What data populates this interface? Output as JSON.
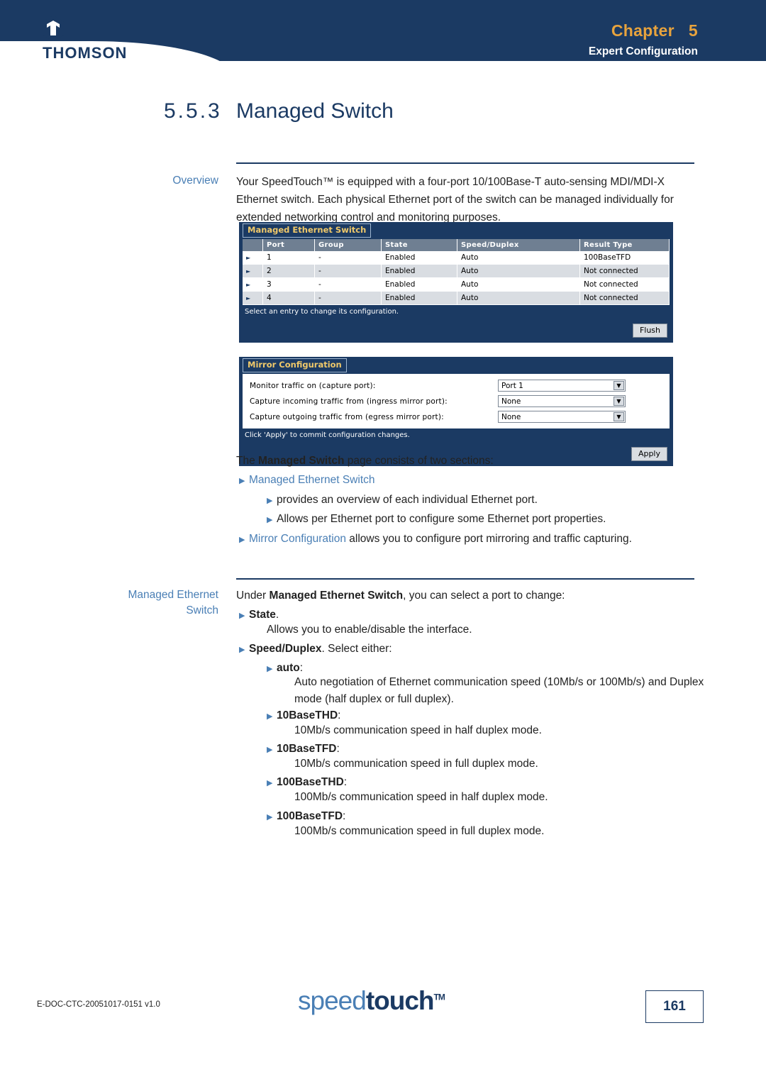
{
  "header": {
    "brand": "THOMSON",
    "chapter_label": "Chapter",
    "chapter_number": "5",
    "chapter_subtitle": "Expert Configuration",
    "accent_color": "#e8a33d",
    "band_color": "#1b3a63"
  },
  "page": {
    "section_number": "5.5.3",
    "section_title": "Managed Switch"
  },
  "overview": {
    "side_label": "Overview",
    "paragraph": "Your SpeedTouch™ is equipped with a four-port 10/100Base-T auto-sensing MDI/MDI-X Ethernet switch. Each physical Ethernet port of the switch can be managed individually for extended networking control and monitoring purposes."
  },
  "screenshot": {
    "switch_panel": {
      "tab_label": "Managed Ethernet Switch",
      "columns": [
        "Port",
        "Group",
        "State",
        "Speed/Duplex",
        "Result Type"
      ],
      "rows": [
        {
          "port": "1",
          "group": "-",
          "state": "Enabled",
          "speed": "Auto",
          "result": "100BaseTFD"
        },
        {
          "port": "2",
          "group": "-",
          "state": "Enabled",
          "speed": "Auto",
          "result": "Not connected"
        },
        {
          "port": "3",
          "group": "-",
          "state": "Enabled",
          "speed": "Auto",
          "result": "Not connected"
        },
        {
          "port": "4",
          "group": "-",
          "state": "Enabled",
          "speed": "Auto",
          "result": "Not connected"
        }
      ],
      "status": "Select an entry to change its configuration.",
      "button": "Flush"
    },
    "mirror_panel": {
      "tab_label": "Mirror Configuration",
      "fields": [
        {
          "label": "Monitor traffic on (capture port):",
          "value": "Port 1"
        },
        {
          "label": "Capture incoming traffic from (ingress mirror port):",
          "value": "None"
        },
        {
          "label": "Capture outgoing traffic from (egress mirror port):",
          "value": "None"
        }
      ],
      "status": "Click 'Apply' to commit configuration changes.",
      "button": "Apply"
    }
  },
  "sections_intro": {
    "lead_pre": "The ",
    "lead_bold": "Managed Switch",
    "lead_post": " page consists of two sections:",
    "item1_title": "Managed Ethernet Switch",
    "item1_sub1": "provides an overview of each individual Ethernet port.",
    "item1_sub2": "Allows per Ethernet port to configure some Ethernet port properties.",
    "item2_title": "Mirror Configuration",
    "item2_rest": " allows you to configure port mirroring and traffic capturing."
  },
  "managed": {
    "side_label_line1": "Managed Ethernet",
    "side_label_line2": "Switch",
    "intro_pre": "Under ",
    "intro_bold": "Managed Ethernet Switch",
    "intro_post": ", you can select a port to change:",
    "state_title": "State",
    "state_desc": "Allows you to enable/disable the interface.",
    "speed_title": "Speed/Duplex",
    "speed_rest": ". Select either:",
    "options": [
      {
        "name": "auto",
        "desc": "Auto negotiation of Ethernet communication speed (10Mb/s or 100Mb/s) and Duplex mode (half duplex or full duplex)."
      },
      {
        "name": "10BaseTHD",
        "desc": "10Mb/s communication speed in half duplex mode."
      },
      {
        "name": "10BaseTFD",
        "desc": "10Mb/s communication speed in full duplex mode."
      },
      {
        "name": "100BaseTHD",
        "desc": "100Mb/s communication speed in half duplex mode."
      },
      {
        "name": "100BaseTFD",
        "desc": "100Mb/s communication speed in full duplex mode."
      }
    ]
  },
  "footer": {
    "doc_id": "E-DOC-CTC-20051017-0151 v1.0",
    "logo_light": "speed",
    "logo_heavy": "touch",
    "logo_tm": "TM",
    "page_number": "161"
  }
}
